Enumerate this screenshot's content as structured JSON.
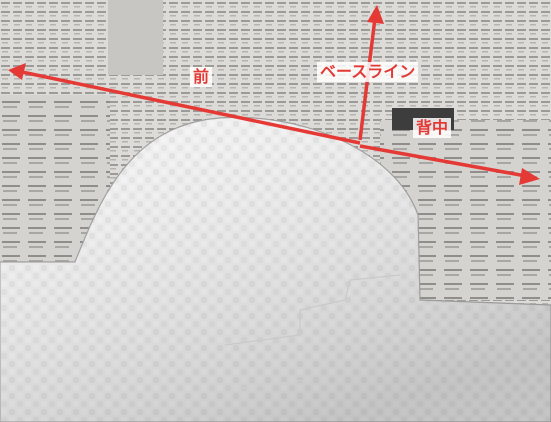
{
  "annotations": {
    "front": "前",
    "baseline": "ベースライン",
    "back": "背中"
  },
  "colors": {
    "arrow": "#e53935",
    "foam": "#f2f2f2",
    "newspaper": "#d9d8d4"
  }
}
